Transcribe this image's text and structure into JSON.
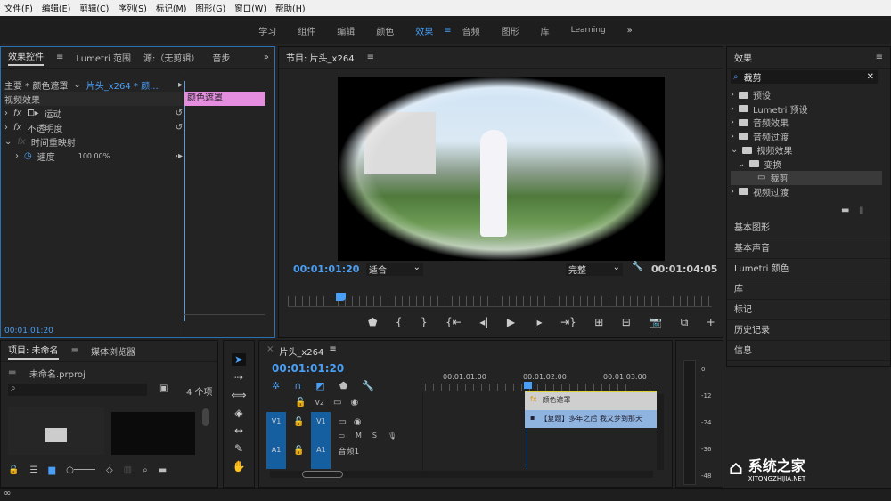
{
  "menu": [
    "文件(F)",
    "编辑(E)",
    "剪辑(C)",
    "序列(S)",
    "标记(M)",
    "图形(G)",
    "窗口(W)",
    "帮助(H)"
  ],
  "workspaces": [
    "学习",
    "组件",
    "编辑",
    "颜色",
    "效果",
    "音频",
    "图形",
    "库",
    "Learning"
  ],
  "active_workspace_index": 4,
  "effect_controls": {
    "tabs": [
      "效果控件",
      "Lumetri 范围",
      "源:（无剪辑）",
      "音步"
    ],
    "master": "主要 * 颜色遮罩",
    "clip": "片头_x264 * 颜...",
    "section": "视频效果",
    "items": [
      "运动",
      "不透明度",
      "时间重映射"
    ],
    "speed_label": "速度",
    "speed_value": "100.00%",
    "clip_bar": "颜色遮罩",
    "timecode": "00:01:01:20"
  },
  "program": {
    "title": "节目: 片头_x264",
    "timecode": "00:01:01:20",
    "fit": "适合",
    "quality": "完整",
    "duration": "00:01:04:05"
  },
  "effects_panel": {
    "title": "效果",
    "search": "裁剪",
    "tree": [
      "预设",
      "Lumetri 预设",
      "音频效果",
      "音频过渡",
      "视频效果",
      "变换",
      "裁剪",
      "视频过渡"
    ],
    "sections": [
      "基本图形",
      "基本声音",
      "Lumetri 颜色",
      "库",
      "标记",
      "历史记录",
      "信息"
    ]
  },
  "project": {
    "tabs": [
      "项目: 未命名",
      "媒体浏览器"
    ],
    "file": "未命名.prproj",
    "count": "4 个项"
  },
  "timeline": {
    "title": "片头_x264",
    "timecode": "00:01:01:20",
    "ruler": [
      "00:01:01:00",
      "00:01:02:00",
      "00:01:03:00"
    ],
    "tracks": {
      "v2": "V2",
      "v1": "V1",
      "a1": "A1",
      "audio_name": "音频1",
      "m": "M",
      "s": "S"
    },
    "clip_v2": "颜色遮罩",
    "clip_v1": "【复题】多年之后 我又梦到那天"
  },
  "meter": [
    "0",
    "-12",
    "-24",
    "-36",
    "-48"
  ],
  "watermark": {
    "title": "系统之家",
    "url": "XITONGZHIJIA.NET"
  }
}
